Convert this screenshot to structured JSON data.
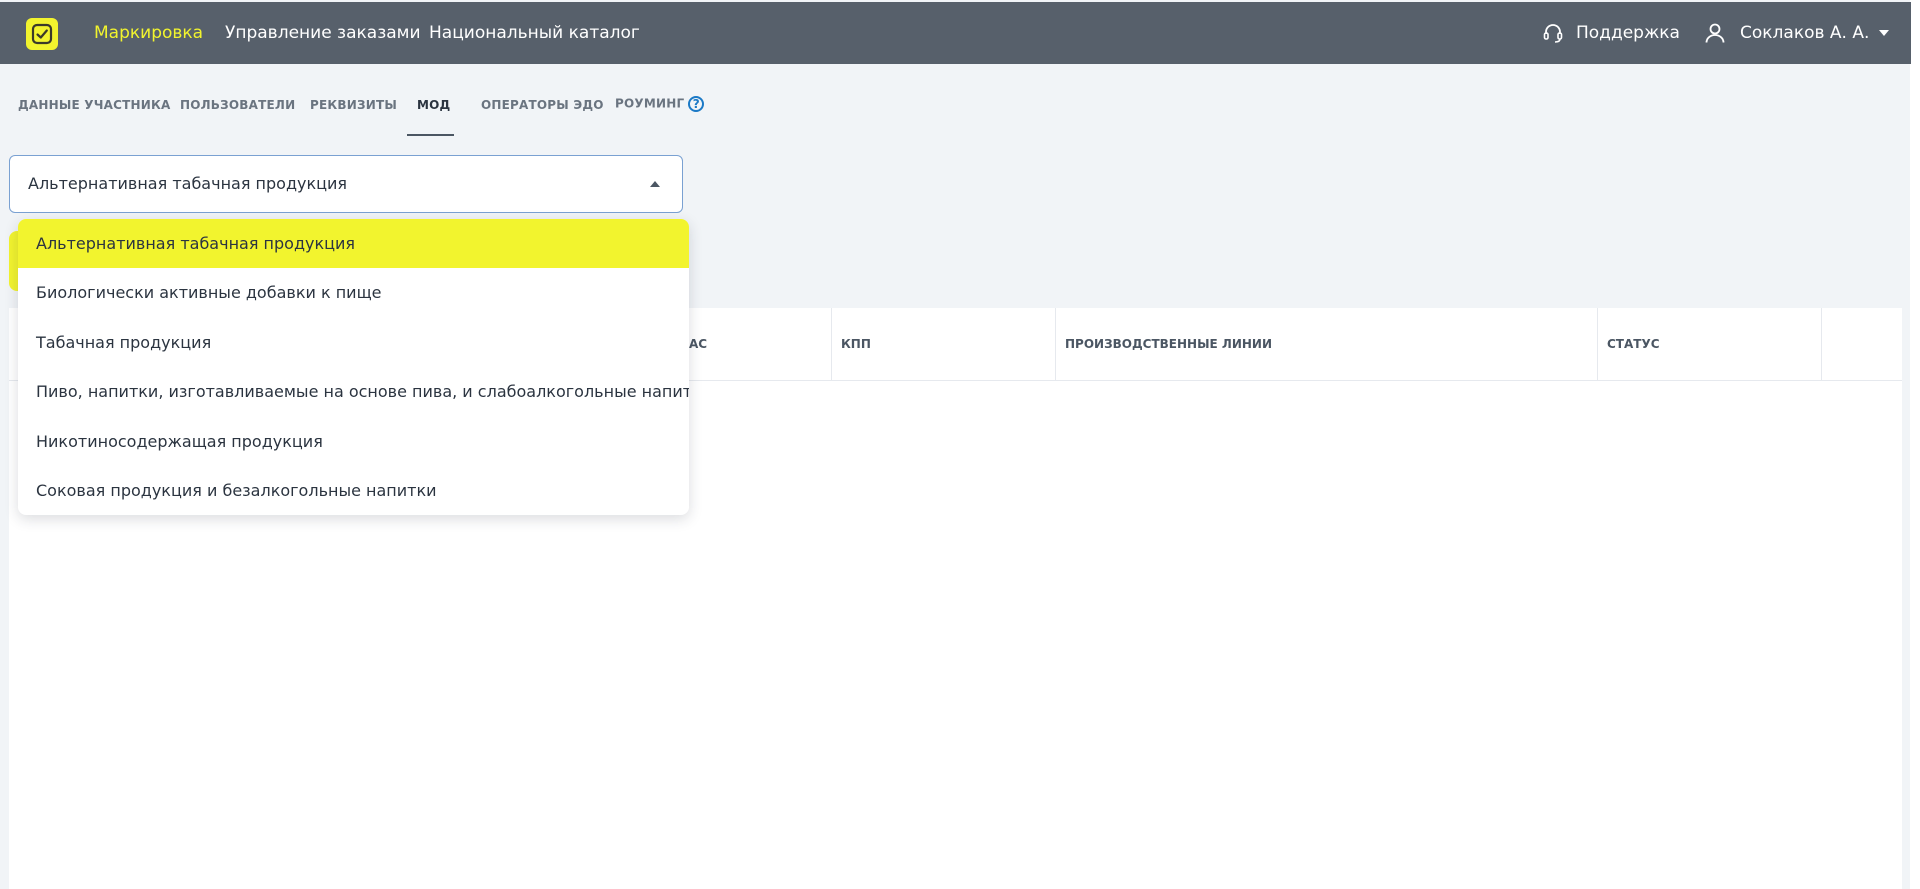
{
  "header": {
    "nav": [
      {
        "label": "Маркировка",
        "active": true
      },
      {
        "label": "Управление заказами",
        "active": false
      },
      {
        "label": "Национальный каталог",
        "active": false
      }
    ],
    "support_label": "Поддержка",
    "user_name": "Соклаков А. А."
  },
  "tabs": [
    {
      "label": "Данные участника",
      "active": false
    },
    {
      "label": "Пользователи",
      "active": false
    },
    {
      "label": "Реквизиты",
      "active": false
    },
    {
      "label": "МОД",
      "active": true
    },
    {
      "label": "Операторы ЭДО",
      "active": false
    },
    {
      "label": "Роуминг",
      "active": false,
      "help_icon": "question-circle-icon"
    }
  ],
  "help_glyph": "?",
  "product_select": {
    "value": "Альтернативная табачная продукция",
    "options": [
      {
        "label": "Альтернативная табачная продукция",
        "selected": true
      },
      {
        "label": "Биологически активные добавки к пище",
        "selected": false
      },
      {
        "label": "Табачная продукция",
        "selected": false
      },
      {
        "label": "Пиво, напитки, изготавливаемые на основе пива, и слабоалкогольные напитки",
        "selected": false
      },
      {
        "label": "Никотиносодержащая продукция",
        "selected": false
      },
      {
        "label": "Соковая продукция и безалкогольные напитки",
        "selected": false
      }
    ]
  },
  "table": {
    "columns": [
      "АС",
      "КПП",
      "Производственные линии",
      "Статус"
    ]
  },
  "colors": {
    "accent": "#f2f42e",
    "header_bg": "#57606b",
    "link_blue": "#1b79c6"
  }
}
